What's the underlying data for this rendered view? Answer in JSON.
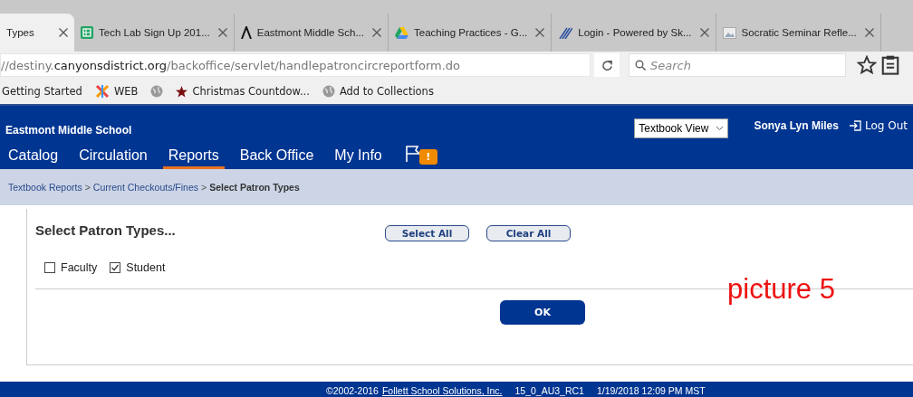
{
  "browser": {
    "tabs": [
      {
        "title": "Types",
        "selected": true
      },
      {
        "title": "Tech Lab Sign Up 201...",
        "selected": false
      },
      {
        "title": "Eastmont Middle Sch...",
        "selected": false
      },
      {
        "title": "Teaching Practices - G...",
        "selected": false
      },
      {
        "title": "Login - Powered by Sk...",
        "selected": false
      },
      {
        "title": "Socratic Seminar Refle...",
        "selected": false
      }
    ],
    "url": {
      "prefix": "//destiny.",
      "domain": "canyonsdistrict.org",
      "path": "/backoffice/servlet/handlepatroncircreportform.do"
    },
    "search": {
      "placeholder": "Search"
    },
    "bookmarks": [
      {
        "label": "Getting Started"
      },
      {
        "label": "WEB"
      },
      {
        "label": "Christmas Countdow..."
      },
      {
        "label": "Add to Collections"
      }
    ]
  },
  "header": {
    "school": "Eastmont Middle School",
    "view_select": "Textbook View",
    "user": "Sonya Lyn Miles",
    "logout": "Log Out",
    "nav": [
      {
        "label": "Catalog",
        "selected": false
      },
      {
        "label": "Circulation",
        "selected": false
      },
      {
        "label": "Reports",
        "selected": true
      },
      {
        "label": "Back Office",
        "selected": false
      },
      {
        "label": "My Info",
        "selected": false
      }
    ],
    "alert_badge": "!"
  },
  "breadcrumb": {
    "links": [
      "Textbook Reports",
      "Current Checkouts/Fines"
    ],
    "current": "Select Patron Types",
    "separator": ">"
  },
  "panel": {
    "title": "Select Patron Types...",
    "buttons": [
      "Select All",
      "Clear All"
    ],
    "patron_types": [
      {
        "label": "Faculty",
        "checked": false
      },
      {
        "label": "Student",
        "checked": true
      }
    ],
    "ok": "OK"
  },
  "annotation": "picture 5",
  "footer": {
    "copyright": "©2002-2016",
    "company": "Follett School Solutions, Inc.",
    "version": "15_0_AU3_RC1",
    "timestamp": "1/19/2018 12:09 PM MST"
  }
}
